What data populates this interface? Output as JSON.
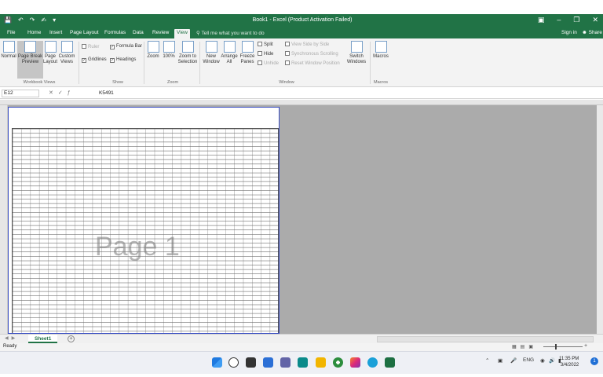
{
  "title_bar": {
    "title": "Book1 - Excel (Product Activation Failed)",
    "qat_icons": [
      "save-icon",
      "undo-icon",
      "redo-icon",
      "touch-icon",
      "customize-icon"
    ]
  },
  "tabs": [
    "File",
    "Home",
    "Insert",
    "Page Layout",
    "Formulas",
    "Data",
    "Review",
    "View"
  ],
  "active_tab": "View",
  "tell_me": "Tell me what you want to do",
  "account": {
    "signin": "Sign in",
    "share": "Share"
  },
  "ribbon": {
    "workbook_views": {
      "group": "Workbook Views",
      "buttons": [
        "Normal",
        "Page Break Preview",
        "Page Layout",
        "Custom Views"
      ]
    },
    "show": {
      "group": "Show",
      "ruler": "Ruler",
      "formula_bar": "Formula Bar",
      "gridlines": "Gridlines",
      "headings": "Headings"
    },
    "zoom": {
      "group": "Zoom",
      "buttons": [
        "Zoom",
        "100%",
        "Zoom to Selection"
      ]
    },
    "window": {
      "group": "Window",
      "buttons": [
        "New Window",
        "Arrange All",
        "Freeze Panes"
      ],
      "split": "Split",
      "hide": "Hide",
      "unhide": "Unhide",
      "side_by_side": "View Side by Side",
      "sync_scroll": "Synchronous Scrolling",
      "reset_pos": "Reset Window Position",
      "switch": "Switch Windows"
    },
    "macros": {
      "group": "Macros",
      "button": "Macros"
    }
  },
  "formula_bar": {
    "name_box": "E12",
    "value": "K5491"
  },
  "page_label": "Page 1",
  "sheet_tab": "Sheet1",
  "status": {
    "ready": "Ready"
  },
  "taskbar": {
    "lang": "ENG",
    "time": "11:35 PM",
    "date": "3/4/2022"
  }
}
